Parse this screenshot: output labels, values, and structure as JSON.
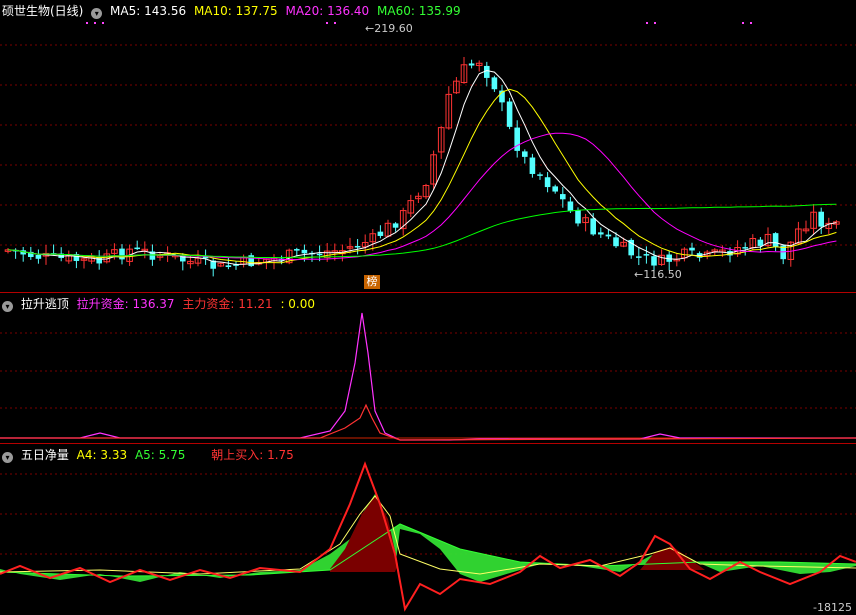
{
  "main": {
    "title": "硕世生物(日线)",
    "ma5_label": "MA5:",
    "ma5": "143.56",
    "ma10_label": "MA10:",
    "ma10": "137.75",
    "ma20_label": "MA20:",
    "ma20": "136.40",
    "ma60_label": "MA60:",
    "ma60": "135.99",
    "high_mark": "219.60",
    "low_mark": "116.50",
    "badge": "榜",
    "colors": {
      "ma5": "#ffffff",
      "ma10": "#ffff00",
      "ma20": "#ff00ff",
      "ma60": "#00ff00",
      "up": "#ff3333",
      "down": "#54ffff"
    }
  },
  "ind1": {
    "title": "拉升逃顶",
    "a_label": "拉升资金:",
    "a_value": "136.37",
    "b_label": "主力资金:",
    "b_value": "11.21",
    "c_value": ": 0.00"
  },
  "ind2": {
    "title": "五日净量",
    "a4_label": "A4:",
    "a4": "3.33",
    "a5_label": "A5:",
    "a5": "5.75",
    "buy_label": "朝上买入:",
    "buy": "1.75",
    "bottom_value": "-18125"
  }
}
